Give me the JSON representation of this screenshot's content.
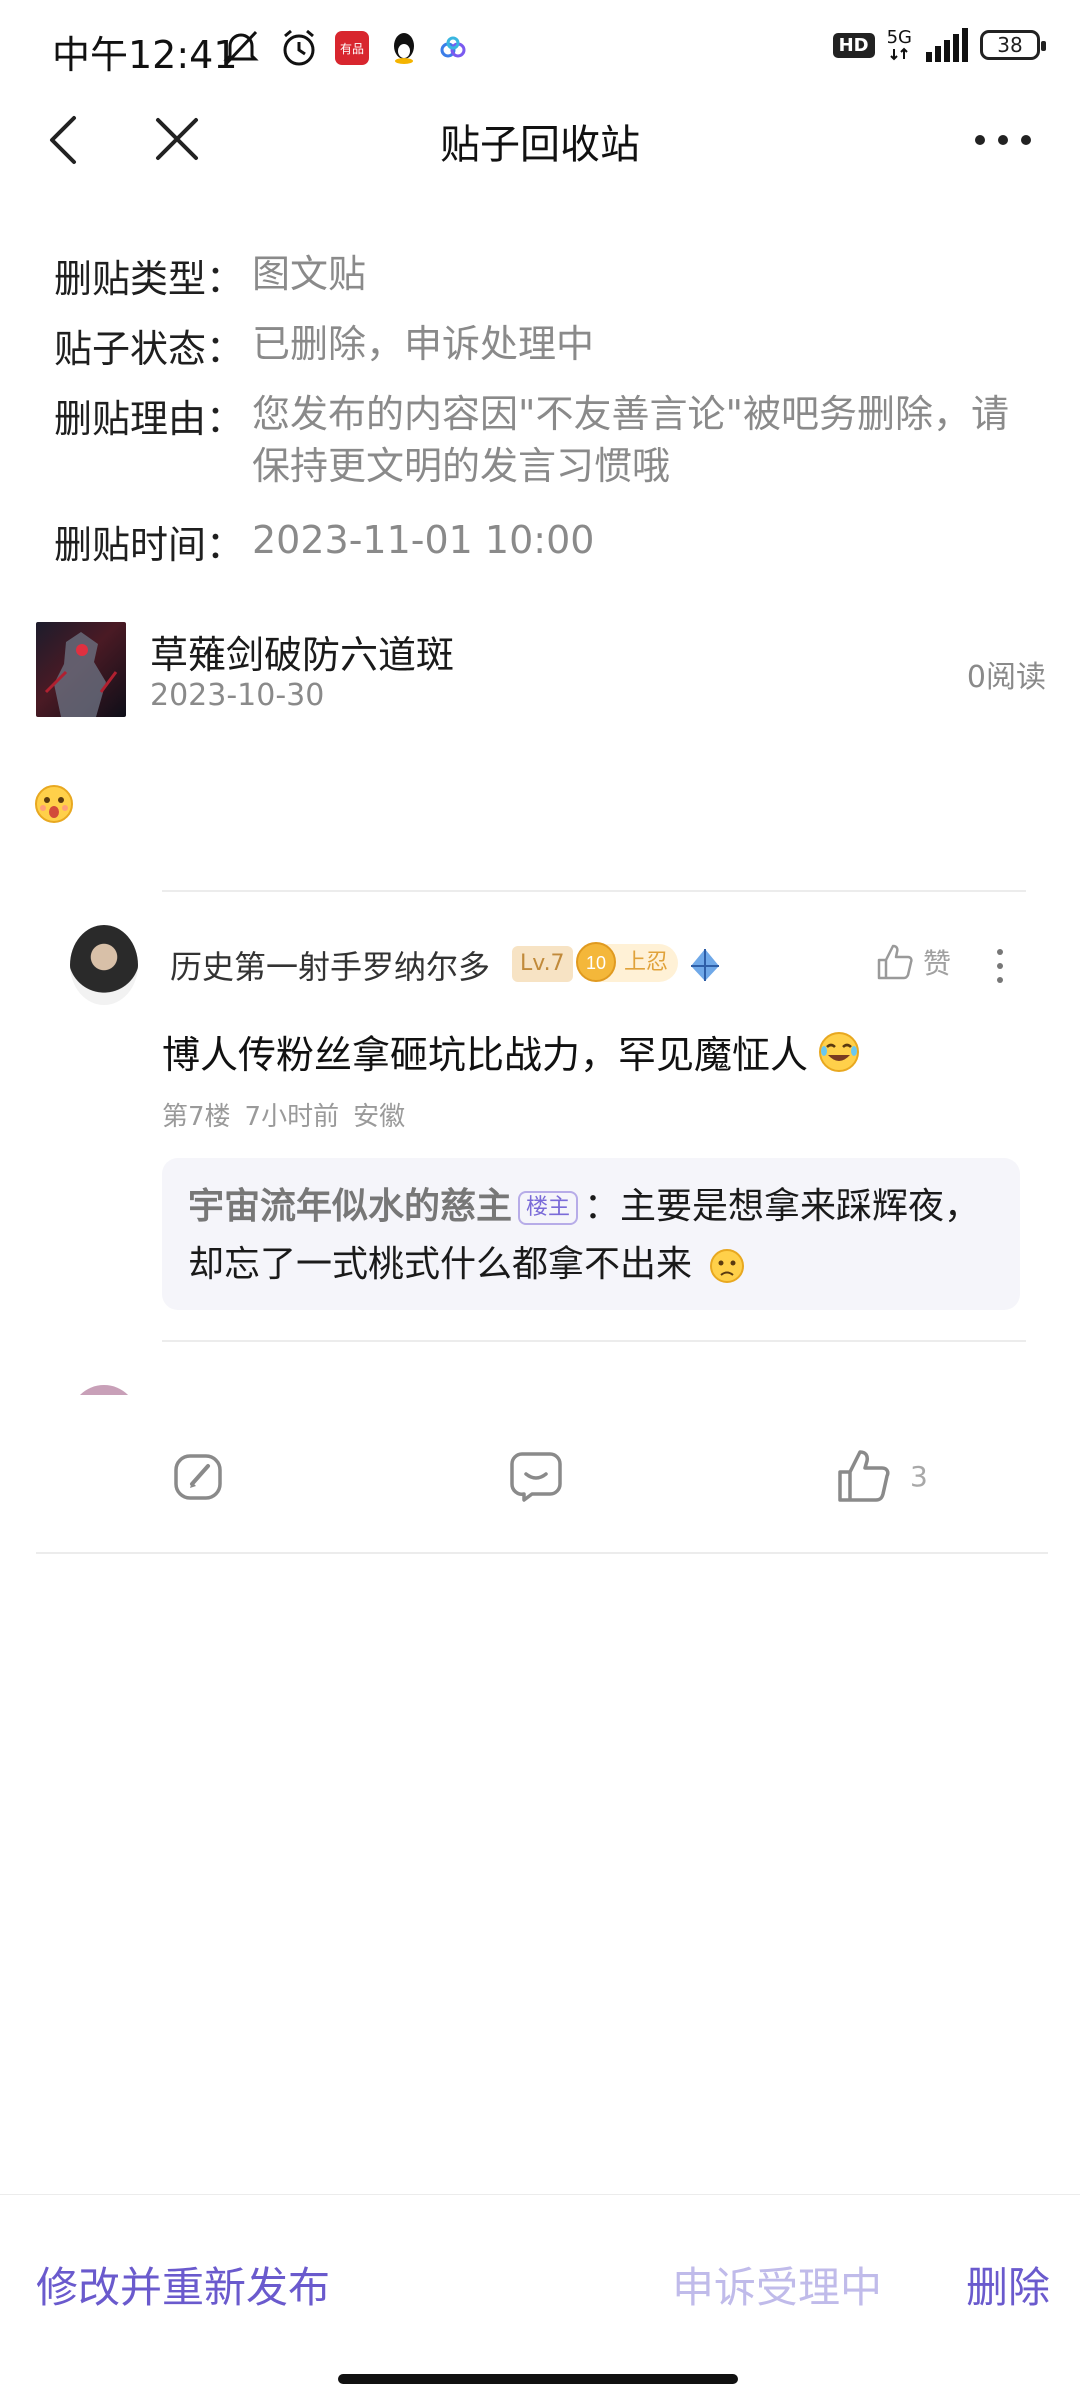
{
  "status_bar": {
    "time": "中午12:41",
    "network": "5G",
    "hd": "HD",
    "battery": "38",
    "app_badge": "有品"
  },
  "nav": {
    "title": "贴子回收站"
  },
  "info": [
    {
      "label": "删贴类型：",
      "value": "图文贴"
    },
    {
      "label": "贴子状态：",
      "value": "已删除，申诉处理中"
    },
    {
      "label": "删贴理由：",
      "value": "您发布的内容因\"不友善言论\"被吧务删除，请保持更文明的发言习惯哦"
    },
    {
      "label": "删贴时间：",
      "value": "2023-11-01 10:00"
    }
  ],
  "post": {
    "title": "草薙剑破防六道斑",
    "date": "2023-10-30",
    "reads": "0阅读"
  },
  "comment": {
    "author": "历史第一射手罗纳尔多",
    "level": "Lv.7",
    "rank_number": "10",
    "rank": "上忍",
    "like_label": "赞",
    "text": "博人传粉丝拿砸坑比战力，罕见魔怔人",
    "floor": "第7楼",
    "time_ago": "7小时前",
    "location": "安徽",
    "reply": {
      "author": "宇宙流年似水的慈主",
      "badge": "楼主",
      "separator": "：",
      "text": "主要是想拿来踩辉夜，却忘了一式桃式什么都拿不出来"
    }
  },
  "actions": {
    "like_count": "3"
  },
  "bottom": {
    "edit_label": "修改并重新发布",
    "appeal_label": "申诉受理中",
    "delete_label": "删除"
  },
  "colors": {
    "accent": "#6a5acd",
    "accent_disabled": "#c0bbea",
    "muted_text": "#8a8a8a"
  }
}
